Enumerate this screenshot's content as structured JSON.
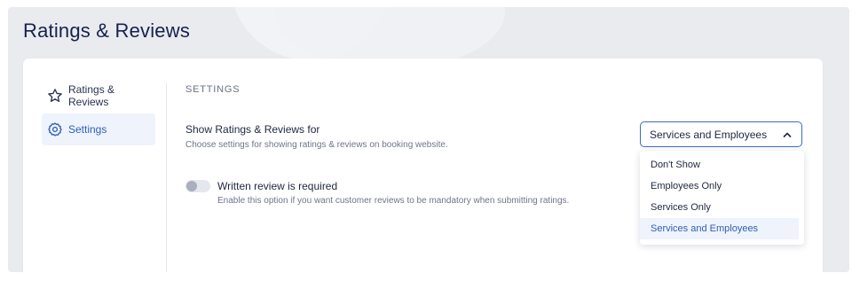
{
  "page": {
    "title": "Ratings & Reviews"
  },
  "sidebar": {
    "items": [
      {
        "label": "Ratings & Reviews",
        "icon": "star-icon",
        "active": false
      },
      {
        "label": "Settings",
        "icon": "gear-icon",
        "active": true
      }
    ]
  },
  "settings": {
    "section_title": "SETTINGS",
    "show_ratings": {
      "label": "Show Ratings & Reviews for",
      "description": "Choose settings for showing ratings & reviews on booking website.",
      "selected": "Services and Employees",
      "options": [
        "Don't Show",
        "Employees Only",
        "Services Only",
        "Services and Employees"
      ],
      "dropdown_open": true
    },
    "written_review": {
      "label": "Written review is required",
      "description": "Enable this option if you want customer reviews to be mandatory when submitting ratings.",
      "enabled": false
    }
  },
  "colors": {
    "accent": "#2f5fb3",
    "title": "#15224a",
    "background": "#e9ebef"
  }
}
